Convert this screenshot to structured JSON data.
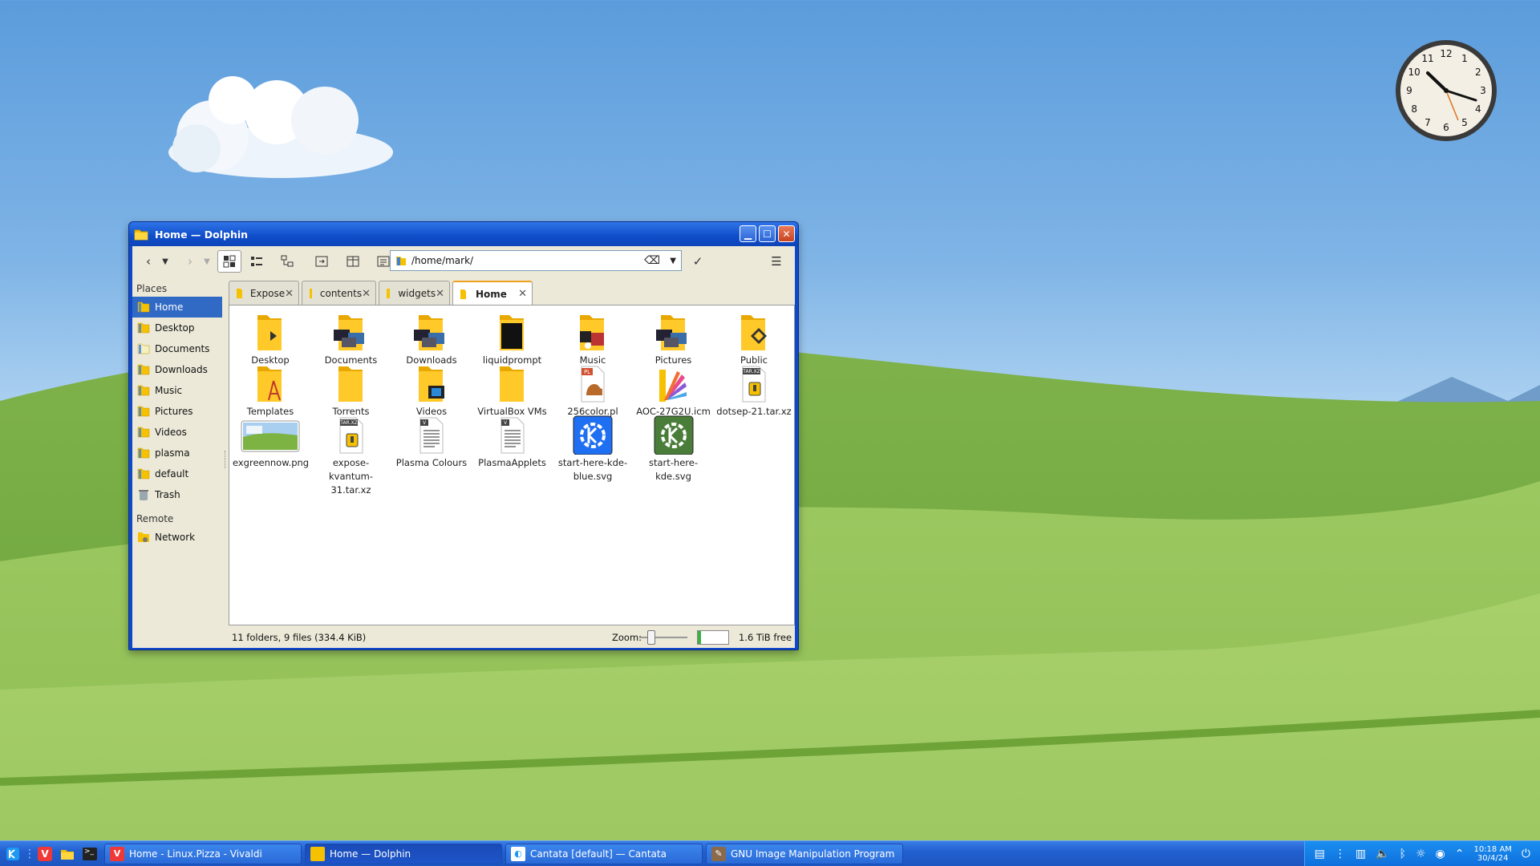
{
  "window": {
    "title": "Home — Dolphin"
  },
  "toolbar": {
    "url": "/home/mark/"
  },
  "places": {
    "heading": "Places",
    "items": [
      {
        "label": "Home",
        "color": "#f5c100"
      },
      {
        "label": "Desktop",
        "color": "#f5c100"
      },
      {
        "label": "Documents",
        "color": "#f5f0c0"
      },
      {
        "label": "Downloads",
        "color": "#f5c100"
      },
      {
        "label": "Music",
        "color": "#f5c100"
      },
      {
        "label": "Pictures",
        "color": "#f5c100"
      },
      {
        "label": "Videos",
        "color": "#f5c100"
      },
      {
        "label": "plasma",
        "color": "#f5c100"
      },
      {
        "label": "default",
        "color": "#f5c100"
      },
      {
        "label": "Trash",
        "color": "#9aa8b0"
      }
    ],
    "remote_heading": "Remote",
    "remote_items": [
      {
        "label": "Network"
      }
    ]
  },
  "tabs": [
    {
      "label": "Expose"
    },
    {
      "label": "contents"
    },
    {
      "label": "widgets"
    },
    {
      "label": "Home"
    }
  ],
  "files": [
    {
      "label": "Desktop",
      "icon": "folder-desktop-icon"
    },
    {
      "label": "Documents",
      "icon": "folder-documents-icon"
    },
    {
      "label": "Downloads",
      "icon": "folder-downloads-icon"
    },
    {
      "label": "liquidprompt",
      "icon": "folder-icon"
    },
    {
      "label": "Music",
      "icon": "folder-music-icon"
    },
    {
      "label": "Pictures",
      "icon": "folder-pictures-icon"
    },
    {
      "label": "Public",
      "icon": "folder-public-icon"
    },
    {
      "label": "Templates",
      "icon": "folder-templates-icon"
    },
    {
      "label": "Torrents",
      "icon": "folder-icon"
    },
    {
      "label": "Videos",
      "icon": "folder-videos-icon"
    },
    {
      "label": "VirtualBox VMs",
      "icon": "folder-icon"
    },
    {
      "label": "256color.pl",
      "icon": "perl-file-icon",
      "badge": "PL"
    },
    {
      "label": "AOC-27G2U.icm",
      "icon": "color-profile-icon"
    },
    {
      "label": "dotsep-21.tar.xz",
      "icon": "archive-icon",
      "badge": "TAR.XZ"
    },
    {
      "label": "exgreennow.png",
      "icon": "image-file-icon"
    },
    {
      "label": "expose-kvantum-31.tar.xz",
      "icon": "archive-icon",
      "badge": "TAR.XZ"
    },
    {
      "label": "Plasma Colours",
      "icon": "text-file-icon",
      "badge": "V"
    },
    {
      "label": "PlasmaApplets",
      "icon": "text-file-icon",
      "badge": "V"
    },
    {
      "label": "start-here-kde-blue.svg",
      "icon": "kde-blue-icon"
    },
    {
      "label": "start-here-kde.svg",
      "icon": "kde-green-icon"
    }
  ],
  "status": {
    "summary": "11 folders, 9 files (334.4 KiB)",
    "zoom_label": "Zoom:",
    "free": "1.6 TiB free",
    "zoom_level": 0.25
  },
  "taskbar": {
    "tasks": [
      {
        "label": "Home - Linux.Pizza - Vivaldi",
        "icon": "vivaldi-icon"
      },
      {
        "label": "Home — Dolphin",
        "icon": "dolphin-icon"
      },
      {
        "label": "Cantata [default] — Cantata",
        "icon": "cantata-icon"
      },
      {
        "label": "GNU Image Manipulation Program",
        "icon": "gimp-icon"
      }
    ],
    "time": "10:18 AM",
    "date": "30/4/24"
  },
  "clock": {
    "numbers": [
      "12",
      "1",
      "2",
      "3",
      "4",
      "5",
      "6",
      "7",
      "8",
      "9",
      "10",
      "11"
    ]
  }
}
